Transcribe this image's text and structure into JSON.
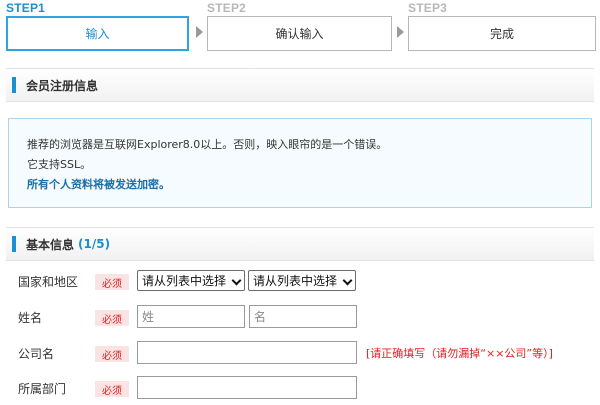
{
  "steps": [
    {
      "label": "STEP1",
      "box": "输入",
      "active": true
    },
    {
      "label": "STEP2",
      "box": "确认输入",
      "active": false
    },
    {
      "label": "STEP3",
      "box": "完成",
      "active": false
    }
  ],
  "section_member": {
    "title": "会员注册信息"
  },
  "notice": {
    "line1": "推荐的浏览器是互联网Explorer8.0以上。否则，映入眼帘的是一个错误。",
    "line2": "它支持SSL。",
    "line3": "所有个人资料将被发送加密。"
  },
  "section_basic": {
    "title": "基本信息",
    "count": "(1/5)"
  },
  "form": {
    "required_badge": "必须",
    "country": {
      "label": "国家和地区",
      "select1": "请从列表中选择",
      "select2": "请从列表中选择"
    },
    "name": {
      "label": "姓名",
      "surname_placeholder": "姓",
      "given_placeholder": "名"
    },
    "company": {
      "label": "公司名",
      "hint": "[请正确填写（请勿漏掉“××公司”等）]"
    },
    "department": {
      "label": "所属部门"
    }
  },
  "colors": {
    "accent": "#1a8fd1",
    "required_bg": "#fbe3e3",
    "required_text": "#e02020",
    "notice_border": "#a9d4ea"
  }
}
